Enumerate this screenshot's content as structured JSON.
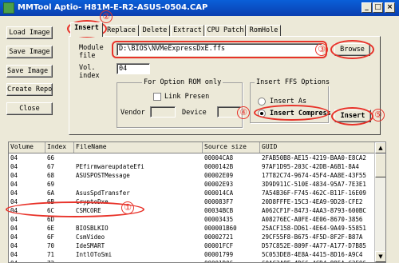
{
  "window": {
    "title": "MMTool Aptio- H81M-E-R2-ASUS-0504.CAP",
    "buttons": {
      "minimize": "_",
      "maximize": "□",
      "close": "×"
    }
  },
  "left_buttons": {
    "load": "Load Image",
    "save": "Save Image",
    "save_as": "Save Image as..",
    "report": "Create Report",
    "close": "Close"
  },
  "tabs": [
    "Insert",
    "Replace",
    "Delete",
    "Extract",
    "CPU Patch",
    "RomHole"
  ],
  "insert_panel": {
    "module_label": "Module\nfile",
    "module_value": "D:\\BIOS\\NVMeExpressDxE.ffs",
    "browse": "Browse",
    "vol_label": "Vol.\nindex",
    "vol_value": "04",
    "option_rom_title": "For Option ROM only",
    "link_present": "Link Presen",
    "vendor_label": "Vendor",
    "device_label": "Device",
    "ffs_title": "Insert FFS Options",
    "insert_as": "Insert As",
    "insert_compress": "Insert Compress",
    "insert_button": "Insert"
  },
  "annotations": [
    "①",
    "②",
    "③",
    "④",
    "⑤"
  ],
  "table": {
    "headers": [
      "Volume",
      "Index",
      "FileName",
      "Source size",
      "GUID"
    ],
    "rows": [
      [
        "04",
        "66",
        "",
        "00004CA8",
        "2FAB50B8-AE15-4219-BAA0-E8CA2"
      ],
      [
        "04",
        "67",
        "PEfirmwareupdateEfi",
        "0000142B",
        "97AF1D95-203C-42DB-A6B1-8A4"
      ],
      [
        "04",
        "68",
        "ASUSPOSTMessage",
        "00002E09",
        "17T82C74-9674-45F4-AA8E-43F55"
      ],
      [
        "04",
        "69",
        "",
        "00002E93",
        "3D9D911C-510E-4834-95A7-7E3E1"
      ],
      [
        "04",
        "6A",
        "AsusSpdTransfer",
        "000014CA",
        "7A54B36F-F745-462C-B11F-16E09"
      ],
      [
        "04",
        "6B",
        "CryptoDxe",
        "000083F7",
        "20D8FFFE-15C3-4EA9-9D28-CFE2"
      ],
      [
        "04",
        "6C",
        "CSMCORE",
        "00034BCB",
        "A062CF1F-8473-4AA3-8793-600BC"
      ],
      [
        "04",
        "6D",
        "",
        "00003435",
        "A08276EC-A0FE-4E06-8670-3856"
      ],
      [
        "04",
        "6E",
        "BIOSBLKIO",
        "000001B60",
        "25ACF158-DD61-4E64-9A49-55851"
      ],
      [
        "04",
        "6F",
        "CsmVideo",
        "00002721",
        "29CF55F8-B675-4F5D-8F2F-B87A"
      ],
      [
        "04",
        "70",
        "IdeSMART",
        "00001FCF",
        "D57C852E-809F-4A77-A177-D7B85"
      ],
      [
        "04",
        "71",
        "IntlOToSmi",
        "00001799",
        "5C053DE8-4E8A-4415-8D16-A9C4"
      ],
      [
        "04",
        "72",
        "",
        "00001D06",
        "60AC3A8F-4D66-4CD4-895A-C3F06"
      ]
    ]
  }
}
